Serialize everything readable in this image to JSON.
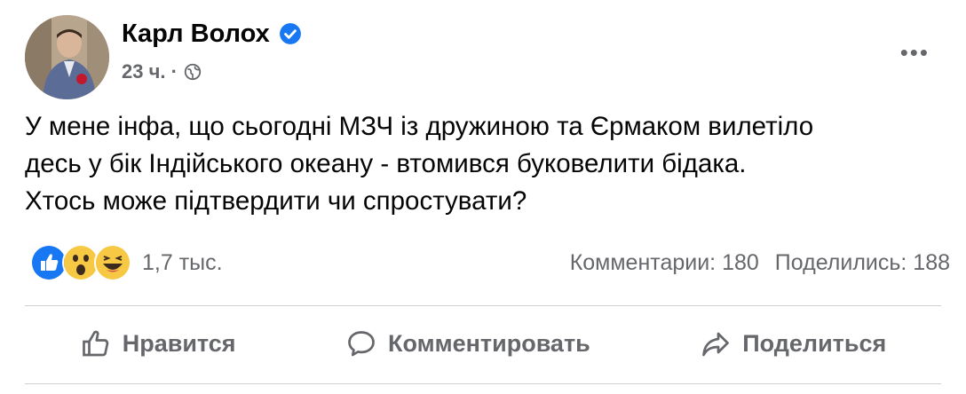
{
  "post": {
    "author": "Карл Волох",
    "time": "23 ч. ·",
    "text_lines": [
      "У мене інфа, що сьогодні МЗЧ із дружиною та Єрмаком вилетіло",
      "десь у бік Індійського океану - втомився буковелити бідака.",
      "Хтось може підтвердити чи спростувати?"
    ],
    "more_label": "•••"
  },
  "stats": {
    "reactions_count": "1,7 тыс.",
    "comments": "Комментарии: 180",
    "shares": "Поделились: 188"
  },
  "actions": {
    "like": "Нравится",
    "comment": "Комментировать",
    "share": "Поделиться"
  },
  "colors": {
    "secondary_text": "#65676b",
    "verified_blue": "#1877f2",
    "like_blue": "#1877f2",
    "reaction_yellow": "#f7c844"
  },
  "icons": [
    "verified-badge-icon",
    "globe-icon",
    "more-options-icon",
    "like-reaction-icon",
    "wow-reaction-icon",
    "haha-reaction-icon",
    "thumbs-up-icon",
    "comment-icon",
    "share-icon"
  ]
}
